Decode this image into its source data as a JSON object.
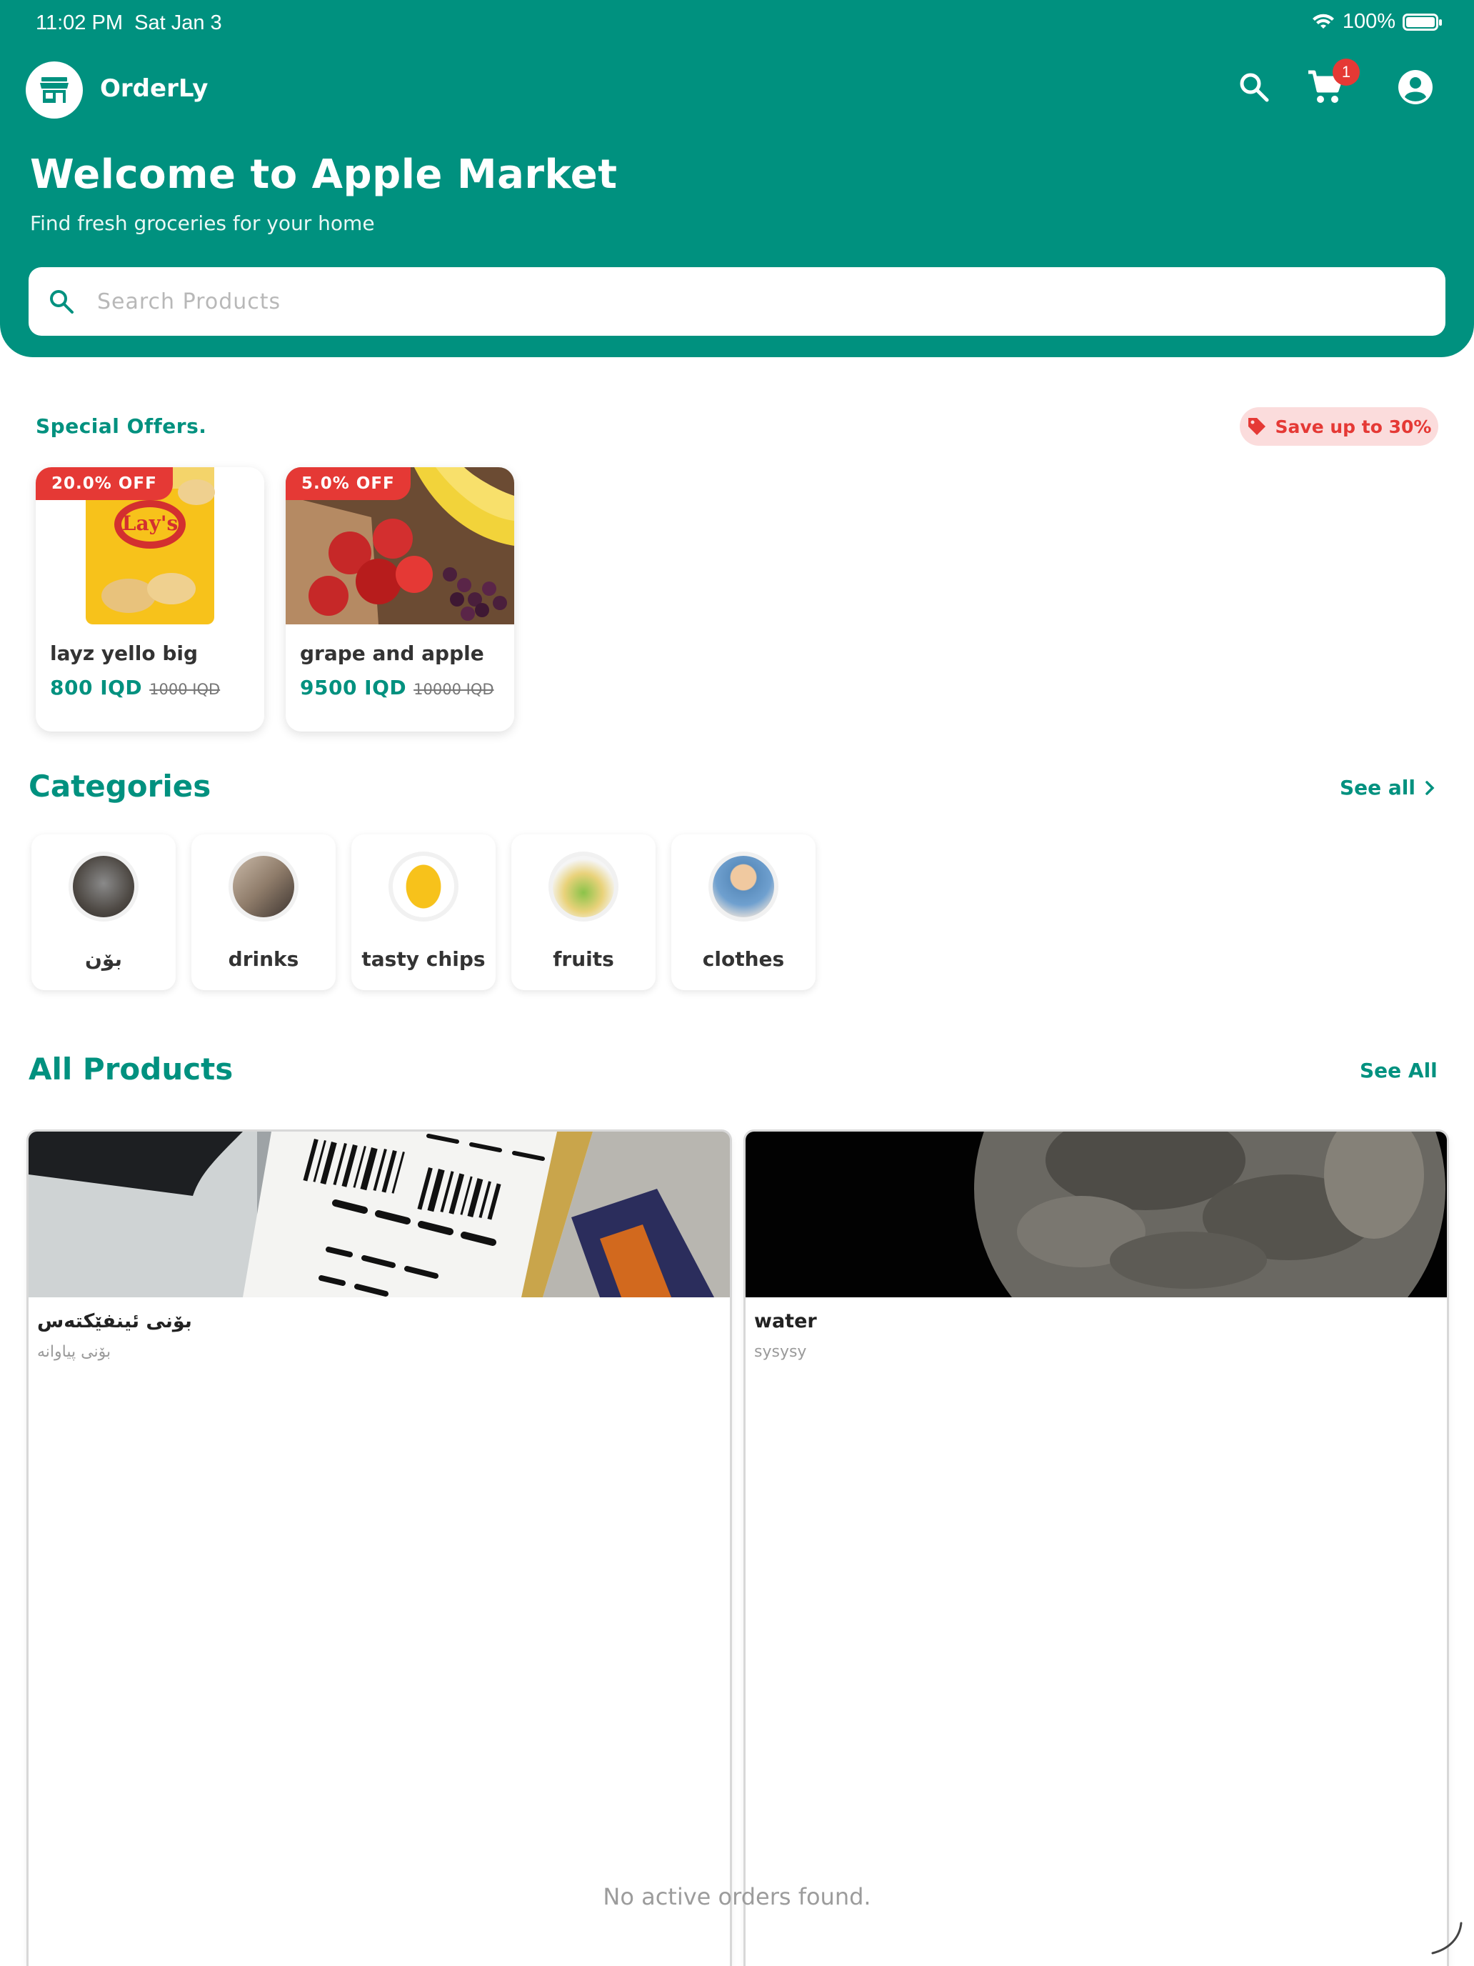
{
  "status_bar": {
    "time": "11:02 PM",
    "date": "Sat Jan 3",
    "battery": "100%"
  },
  "app": {
    "name": "OrderLy",
    "logo_icon": "store-icon",
    "cart_count": "1"
  },
  "hero": {
    "title": "Welcome to Apple Market",
    "subtitle": "Find fresh groceries for your home"
  },
  "search": {
    "placeholder": "Search Products",
    "value": ""
  },
  "offers": {
    "label": "Special Offers.",
    "save_label": "Save up to 30%",
    "items": [
      {
        "badge": "20.0% OFF",
        "name": "layz yello big",
        "price": "800 IQD",
        "old_price": "1000 IQD"
      },
      {
        "badge": "5.0% OFF",
        "name": "grape and apple",
        "price": "9500 IQD",
        "old_price": "10000 IQD"
      }
    ]
  },
  "categories": {
    "title": "Categories",
    "see_all": "See all",
    "items": [
      {
        "label": "بۆن"
      },
      {
        "label": "drinks"
      },
      {
        "label": "tasty chips"
      },
      {
        "label": "fruits"
      },
      {
        "label": "clothes"
      }
    ]
  },
  "products": {
    "title": "All Products",
    "see_all": "See All",
    "items": [
      {
        "name": "بۆنی ئینفێکتەس",
        "description": "بۆنی پیاوانە"
      },
      {
        "name": "water",
        "description": "sysysy"
      }
    ]
  },
  "empty_message": "No active orders found.",
  "colors": {
    "primary": "#00917f",
    "badge_red": "#e53935",
    "save_pill_bg": "#fbdcdc"
  }
}
